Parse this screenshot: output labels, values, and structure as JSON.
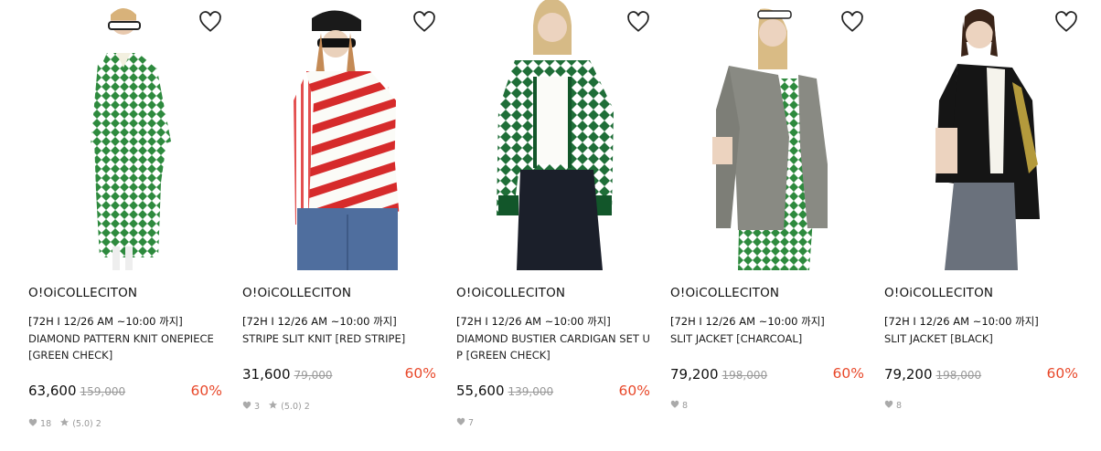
{
  "colors": {
    "discount": "#e8482a",
    "strike": "#999999",
    "meta": "#999999"
  },
  "products": [
    {
      "brand": "O!Oi COLLECITON",
      "brand_text": "O!OiCOLLECITON",
      "tag": "[72H I 12/26 AM ~10:00 까지]",
      "name": "DIAMOND PATTERN KNIT ONEPIECE [GREEN CHECK]",
      "price": "63,600",
      "original_price": "159,000",
      "discount": "60%",
      "likes": "18",
      "rating": "(5.0) 2",
      "icon": "heart-outline-icon"
    },
    {
      "brand": "O!Oi COLLECITON",
      "brand_text": "O!OiCOLLECITON",
      "tag": "[72H I 12/26 AM ~10:00 까지]",
      "name": "STRIPE SLIT KNIT [RED STRIPE]",
      "price": "31,600",
      "original_price": "79,000",
      "discount": "60%",
      "likes": "3",
      "rating": "(5.0) 2",
      "icon": "heart-outline-icon"
    },
    {
      "brand": "O!Oi COLLECITON",
      "brand_text": "O!OiCOLLECITON",
      "tag": "[72H I 12/26 AM ~10:00 까지]",
      "name": "DIAMOND BUSTIER CARDIGAN SET UP [GREEN CHECK]",
      "price": "55,600",
      "original_price": "139,000",
      "discount": "60%",
      "likes": "7",
      "icon": "heart-outline-icon"
    },
    {
      "brand": "O!Oi COLLECITON",
      "brand_text": "O!OiCOLLECITON",
      "tag": "[72H I 12/26 AM ~10:00 까지]",
      "name": "SLIT JACKET [CHARCOAL]",
      "price": "79,200",
      "original_price": "198,000",
      "discount": "60%",
      "likes": "8",
      "icon": "heart-outline-icon"
    },
    {
      "brand": "O!Oi COLLECITON",
      "brand_text": "O!OiCOLLECITON",
      "tag": "[72H I 12/26 AM ~10:00 까지]",
      "name": "SLIT JACKET [BLACK]",
      "price": "79,200",
      "original_price": "198,000",
      "discount": "60%",
      "likes": "8",
      "icon": "heart-outline-icon"
    }
  ]
}
